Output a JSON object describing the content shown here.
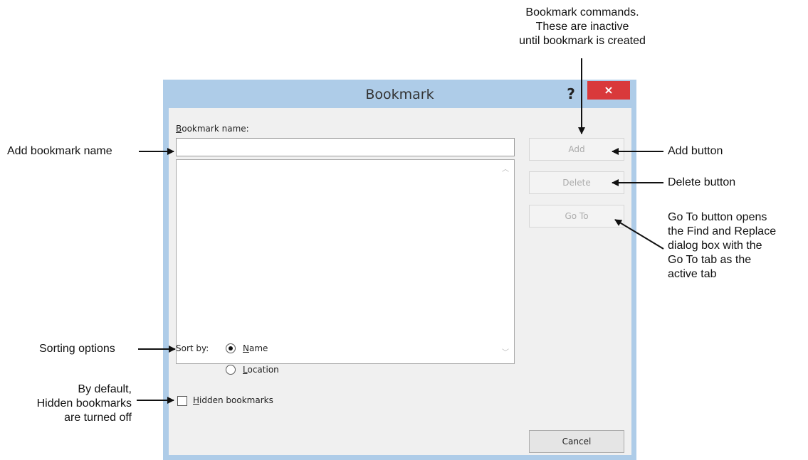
{
  "dialog": {
    "title": "Bookmark",
    "help_symbol": "?",
    "close_symbol": "×",
    "name_label_accel": "B",
    "name_label_rest": "ookmark name:",
    "name_value": "",
    "list_items": [],
    "buttons": {
      "add": "Add",
      "delete": "Delete",
      "goto": "Go To",
      "cancel": "Cancel"
    },
    "sort_label": "Sort by:",
    "sort_options": [
      {
        "accel": "N",
        "rest": "ame",
        "checked": true
      },
      {
        "accel": "L",
        "rest": "ocation",
        "checked": false
      }
    ],
    "hidden_accel": "H",
    "hidden_rest": "idden bookmarks",
    "hidden_checked": false
  },
  "callouts": {
    "commands": "Bookmark commands.\nThese are inactive\nuntil bookmark is created",
    "add_name": "Add bookmark name",
    "add_button": "Add button",
    "delete_button": "Delete button",
    "goto_button": "Go To button opens\nthe Find and Replace\ndialog box with the\nGo To tab as the\nactive tab",
    "sorting": "Sorting options",
    "hidden": "By default,\nHidden bookmarks\nare turned off"
  },
  "colors": {
    "frame": "#aecce8",
    "close": "#d9393b",
    "client": "#f0f0f0"
  }
}
